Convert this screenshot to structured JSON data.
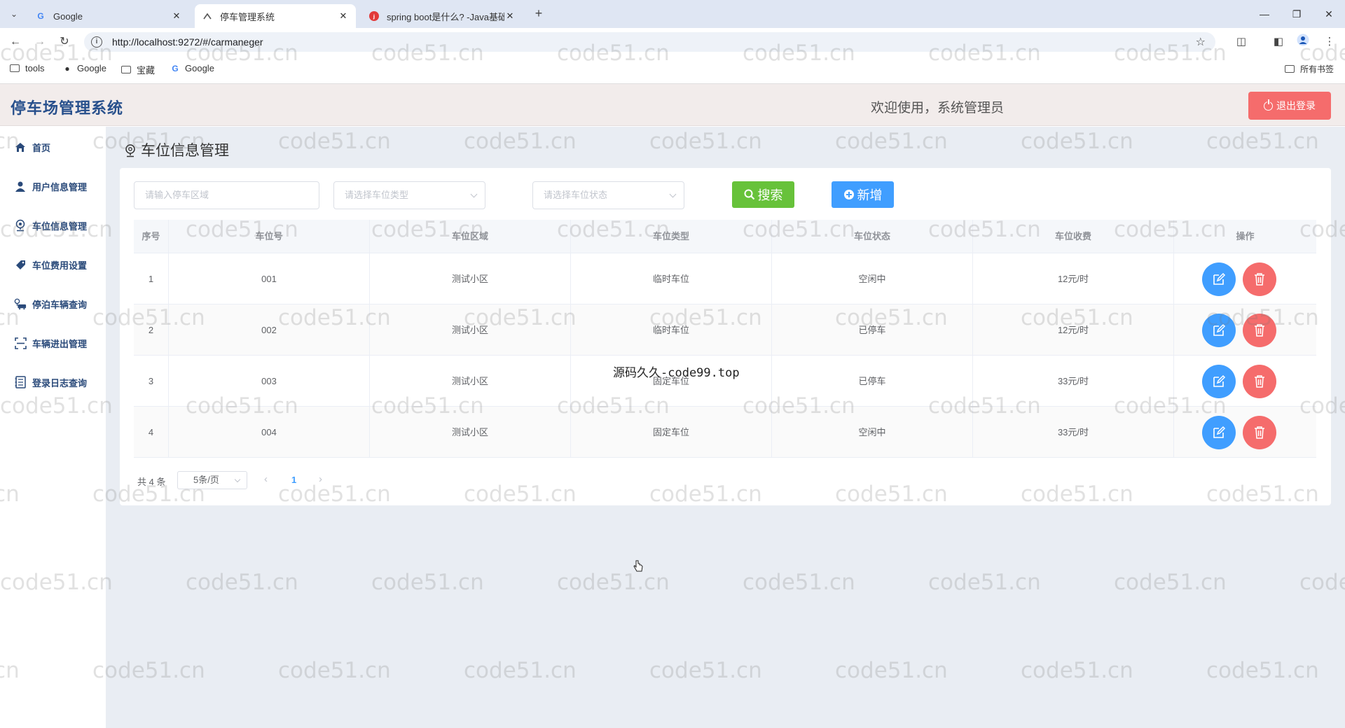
{
  "browser": {
    "tabs": [
      {
        "title": "Google",
        "favicon": "G"
      },
      {
        "title": "停车管理系统",
        "favicon": "parking-icon"
      },
      {
        "title": "spring boot是什么? -Java基础",
        "favicon": "red-logo-icon"
      }
    ],
    "url": "http://localhost:9272/#/carmaneger",
    "bookmarks": [
      "tools",
      "Google",
      "宝藏",
      "Google"
    ],
    "all_bookmarks": "所有书签"
  },
  "header": {
    "title": "停车场管理系统",
    "welcome": "欢迎使用，系统管理员",
    "logout_label": "退出登录"
  },
  "sidebar": {
    "items": [
      {
        "label": "首页",
        "icon": "home-icon"
      },
      {
        "label": "用户信息管理",
        "icon": "user-icon"
      },
      {
        "label": "车位信息管理",
        "icon": "location-icon"
      },
      {
        "label": "车位费用设置",
        "icon": "price-tag-icon"
      },
      {
        "label": "停泊车辆查询",
        "icon": "car-icon"
      },
      {
        "label": "车辆进出管理",
        "icon": "scan-icon"
      },
      {
        "label": "登录日志查询",
        "icon": "log-icon"
      }
    ]
  },
  "page": {
    "title": "车位信息管理"
  },
  "filters": {
    "area_placeholder": "请输入停车区域",
    "type_placeholder": "请选择车位类型",
    "status_placeholder": "请选择车位状态",
    "search_label": "搜索",
    "add_label": "新增"
  },
  "table": {
    "columns": [
      "序号",
      "车位号",
      "车位区域",
      "车位类型",
      "车位状态",
      "车位收费",
      "操作"
    ],
    "rows": [
      [
        "1",
        "001",
        "测试小区",
        "临时车位",
        "空闲中",
        "12元/时"
      ],
      [
        "2",
        "002",
        "测试小区",
        "临时车位",
        "已停车",
        "12元/时"
      ],
      [
        "3",
        "003",
        "测试小区",
        "固定车位",
        "已停车",
        "33元/时"
      ],
      [
        "4",
        "004",
        "测试小区",
        "固定车位",
        "空闲中",
        "33元/时"
      ]
    ]
  },
  "pagination": {
    "total": "共 4 条",
    "page_size": "5条/页",
    "current_page": "1"
  },
  "watermark": {
    "text": "code51.cn",
    "overlay": "源码久久-code99.top"
  },
  "colors": {
    "primary": "#409eff",
    "success": "#67c23a",
    "danger": "#f56c6c",
    "brand": "#28508c"
  }
}
